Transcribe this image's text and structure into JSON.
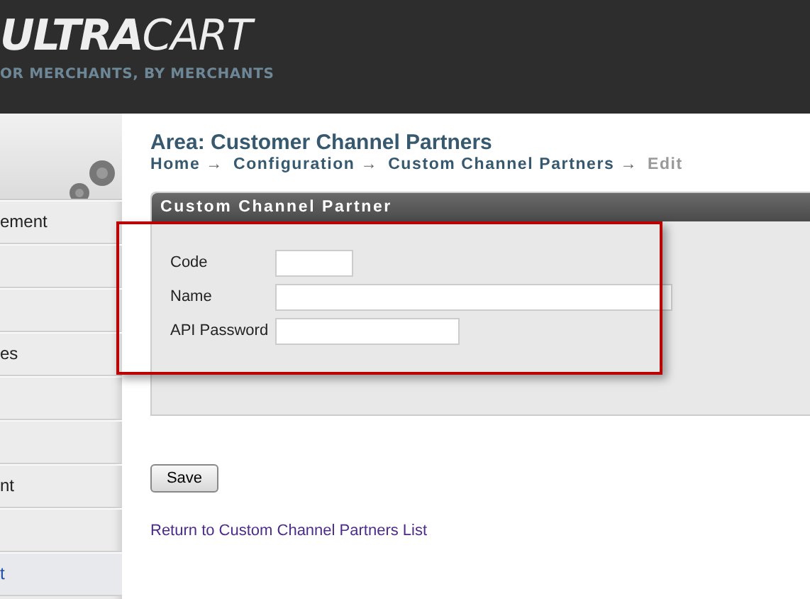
{
  "header": {
    "logo": "**ULTRA**CART",
    "tagline": "OR MERCHANTS, BY MERCHANTS"
  },
  "sidebar": {
    "items": [
      {
        "label": "ement",
        "selected": false
      },
      {
        "selected": false
      },
      {
        "selected": false
      },
      {
        "label": "es",
        "selected": false
      },
      {
        "selected": false
      },
      {
        "selected": false
      },
      {
        "label": "nt",
        "selected": false
      },
      {
        "selected": false
      },
      {
        "label": "t",
        "selected": true
      }
    ]
  },
  "page": {
    "title": "Area: Customer Channel Partners",
    "breadcrumb": [
      {
        "label": "Home",
        "current": false
      },
      {
        "label": "Configuration",
        "current": false
      },
      {
        "label": "Custom Channel Partners",
        "current": false
      },
      {
        "label": "Edit",
        "current": true
      }
    ],
    "separator": "→"
  },
  "panel": {
    "title": "Custom Channel Partner",
    "highlighted": true,
    "fields": [
      {
        "label": "Code"
      },
      {
        "label": "Name"
      },
      {
        "label": "API Password"
      }
    ]
  },
  "save_button": "Save",
  "return_link": "Return to Custom Channel Partners List"
}
